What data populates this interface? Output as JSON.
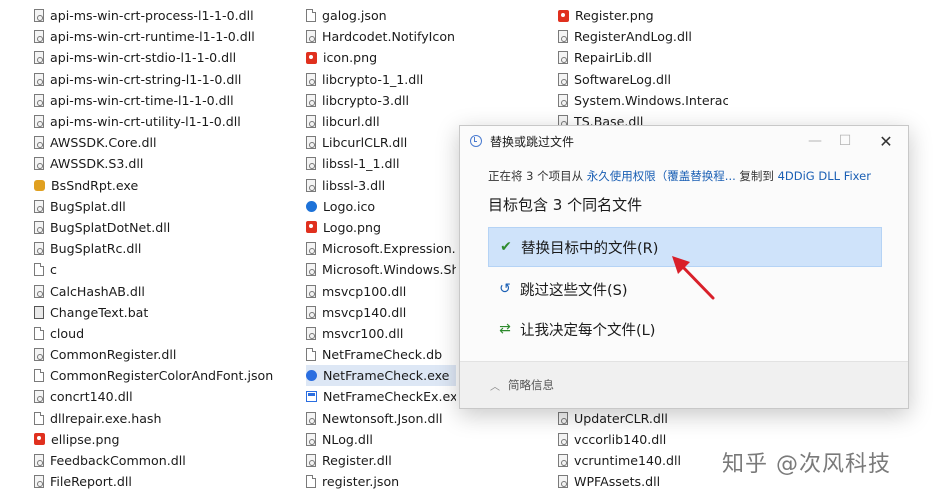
{
  "col1": [
    {
      "name": "api-ms-win-crt-process-l1-1-0.dll",
      "icon": "dll"
    },
    {
      "name": "api-ms-win-crt-runtime-l1-1-0.dll",
      "icon": "dll"
    },
    {
      "name": "api-ms-win-crt-stdio-l1-1-0.dll",
      "icon": "dll"
    },
    {
      "name": "api-ms-win-crt-string-l1-1-0.dll",
      "icon": "dll"
    },
    {
      "name": "api-ms-win-crt-time-l1-1-0.dll",
      "icon": "dll"
    },
    {
      "name": "api-ms-win-crt-utility-l1-1-0.dll",
      "icon": "dll"
    },
    {
      "name": "AWSSDK.Core.dll",
      "icon": "dll"
    },
    {
      "name": "AWSSDK.S3.dll",
      "icon": "dll"
    },
    {
      "name": "BsSndRpt.exe",
      "icon": "bug"
    },
    {
      "name": "BugSplat.dll",
      "icon": "dll"
    },
    {
      "name": "BugSplatDotNet.dll",
      "icon": "dll"
    },
    {
      "name": "BugSplatRc.dll",
      "icon": "dll"
    },
    {
      "name": "c",
      "icon": "doc"
    },
    {
      "name": "CalcHashAB.dll",
      "icon": "dll"
    },
    {
      "name": "ChangeText.bat",
      "icon": "bat"
    },
    {
      "name": "cloud",
      "icon": "doc"
    },
    {
      "name": "CommonRegister.dll",
      "icon": "dll"
    },
    {
      "name": "CommonRegisterColorAndFont.json",
      "icon": "doc"
    },
    {
      "name": "concrt140.dll",
      "icon": "dll"
    },
    {
      "name": "dllrepair.exe.hash",
      "icon": "doc"
    },
    {
      "name": "ellipse.png",
      "icon": "png"
    },
    {
      "name": "FeedbackCommon.dll",
      "icon": "dll"
    },
    {
      "name": "FileReport.dll",
      "icon": "dll"
    }
  ],
  "col2": [
    {
      "name": "galog.json",
      "icon": "doc"
    },
    {
      "name": "Hardcodet.NotifyIcon.Wpf.dll",
      "icon": "dll"
    },
    {
      "name": "icon.png",
      "icon": "png"
    },
    {
      "name": "libcrypto-1_1.dll",
      "icon": "dll"
    },
    {
      "name": "libcrypto-3.dll",
      "icon": "dll"
    },
    {
      "name": "libcurl.dll",
      "icon": "dll"
    },
    {
      "name": "LibcurlCLR.dll",
      "icon": "dll"
    },
    {
      "name": "libssl-1_1.dll",
      "icon": "dll"
    },
    {
      "name": "libssl-3.dll",
      "icon": "dll"
    },
    {
      "name": "Logo.ico",
      "icon": "logo"
    },
    {
      "name": "Logo.png",
      "icon": "png"
    },
    {
      "name": "Microsoft.Expression.Dra",
      "icon": "dll"
    },
    {
      "name": "Microsoft.Windows.Shel",
      "icon": "dll"
    },
    {
      "name": "msvcp100.dll",
      "icon": "dll"
    },
    {
      "name": "msvcp140.dll",
      "icon": "dll"
    },
    {
      "name": "msvcr100.dll",
      "icon": "dll"
    },
    {
      "name": "NetFrameCheck.db",
      "icon": "doc"
    },
    {
      "name": "NetFrameCheck.exe",
      "icon": "exe",
      "selected": true
    },
    {
      "name": "NetFrameCheckEx.exe",
      "icon": "exe2"
    },
    {
      "name": "Newtonsoft.Json.dll",
      "icon": "dll"
    },
    {
      "name": "NLog.dll",
      "icon": "dll"
    },
    {
      "name": "Register.dll",
      "icon": "dll"
    },
    {
      "name": "register.json",
      "icon": "doc"
    }
  ],
  "col3": [
    {
      "name": "Register.png",
      "icon": "png"
    },
    {
      "name": "RegisterAndLog.dll",
      "icon": "dll"
    },
    {
      "name": "RepairLib.dll",
      "icon": "dll"
    },
    {
      "name": "SoftwareLog.dll",
      "icon": "dll"
    },
    {
      "name": "System.Windows.Interactiv",
      "icon": "dll"
    },
    {
      "name": "TS.Base.dll",
      "icon": "dll"
    },
    {
      "name": "",
      "icon": "none"
    },
    {
      "name": "",
      "icon": "none"
    },
    {
      "name": "",
      "icon": "none"
    },
    {
      "name": "",
      "icon": "none"
    },
    {
      "name": "",
      "icon": "none"
    },
    {
      "name": "",
      "icon": "none"
    },
    {
      "name": "",
      "icon": "none"
    },
    {
      "name": "",
      "icon": "none"
    },
    {
      "name": "",
      "icon": "none"
    },
    {
      "name": "",
      "icon": "none"
    },
    {
      "name": "",
      "icon": "none"
    },
    {
      "name": "",
      "icon": "none"
    },
    {
      "name": "",
      "icon": "none"
    },
    {
      "name": "UpdaterCLR.dll",
      "icon": "dll"
    },
    {
      "name": "vccorlib140.dll",
      "icon": "dll"
    },
    {
      "name": "vcruntime140.dll",
      "icon": "dll"
    },
    {
      "name": "WPFAssets.dll",
      "icon": "dll"
    }
  ],
  "dialog": {
    "title": "替换或跳过文件",
    "min_glyph": "—",
    "max_glyph": "☐",
    "close_glyph": "✕",
    "from_prefix": "正在将 3 个项目从 ",
    "from_source": "永久使用权限（覆盖替换程...",
    "from_mid": " 复制到 ",
    "from_dest": "4DDiG DLL Fixer",
    "heading": "目标包含 3 个同名文件",
    "option_replace": "替换目标中的文件(R)",
    "option_skip": "跳过这些文件(S)",
    "option_decide": "让我决定每个文件(L)",
    "details": "简略信息",
    "details_chevron": "︿"
  },
  "watermark": "知乎 @次风科技",
  "colors": {
    "accent": "#1a5fb4",
    "highlight": "#cfe3fa",
    "arrow": "#d9202a",
    "check": "#2e8b2e"
  }
}
